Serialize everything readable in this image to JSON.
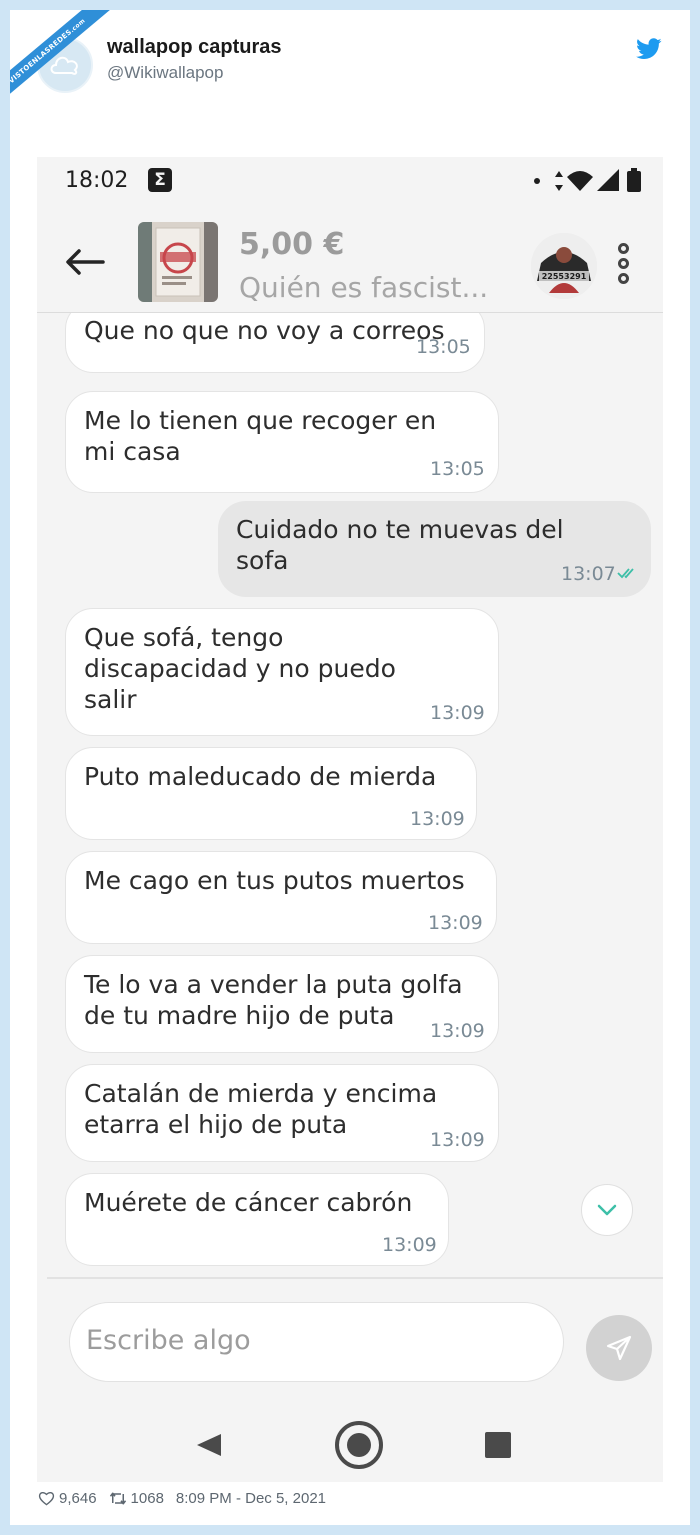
{
  "ribbon": {
    "text": "VISTOENLASREDES",
    "sub": ".com"
  },
  "tweet": {
    "display_name": "wallapop capturas",
    "handle": "@Wikiwallapop",
    "likes": "9,646",
    "retweets": "1068",
    "timestamp": "8:09 PM - Dec 5, 2021"
  },
  "phone": {
    "status": {
      "time": "18:02",
      "indicator": "Σ",
      "icons": [
        "dot-icon",
        "data-arrows-icon",
        "wifi-icon",
        "signal-icon",
        "battery-icon"
      ]
    },
    "appbar": {
      "price": "5,00 €",
      "title": "Quién es fascist...",
      "seller_tag": "22553291"
    },
    "messages": [
      {
        "dir": "in",
        "text": "Que no que no voy a correos",
        "time": "13:05"
      },
      {
        "dir": "in",
        "text": "Me lo tienen que recoger en\nmi casa",
        "time": "13:05"
      },
      {
        "dir": "out",
        "text": "Cuidado no te muevas del\nsofa",
        "time": "13:07"
      },
      {
        "dir": "in",
        "text": "Que sofá, tengo\ndiscapacidad y no puedo\nsalir",
        "time": "13:09"
      },
      {
        "dir": "in",
        "text": "Puto maleducado de mierda",
        "time": "13:09"
      },
      {
        "dir": "in",
        "text": "Me cago en tus putos muertos",
        "time": "13:09"
      },
      {
        "dir": "in",
        "text": "Te lo va a vender la puta golfa\nde tu madre hijo de puta",
        "time": "13:09"
      },
      {
        "dir": "in",
        "text": "Catalán de mierda y encima\netarra el hijo de puta",
        "time": "13:09"
      },
      {
        "dir": "in",
        "text": "Muérete de cáncer cabrón",
        "time": "13:09"
      }
    ],
    "input": {
      "placeholder": "Escribe algo"
    }
  },
  "colors": {
    "twitter_blue": "#1d9bf0",
    "read_ticks": "#3dbfa8",
    "page_bg": "#cfe5f5"
  }
}
